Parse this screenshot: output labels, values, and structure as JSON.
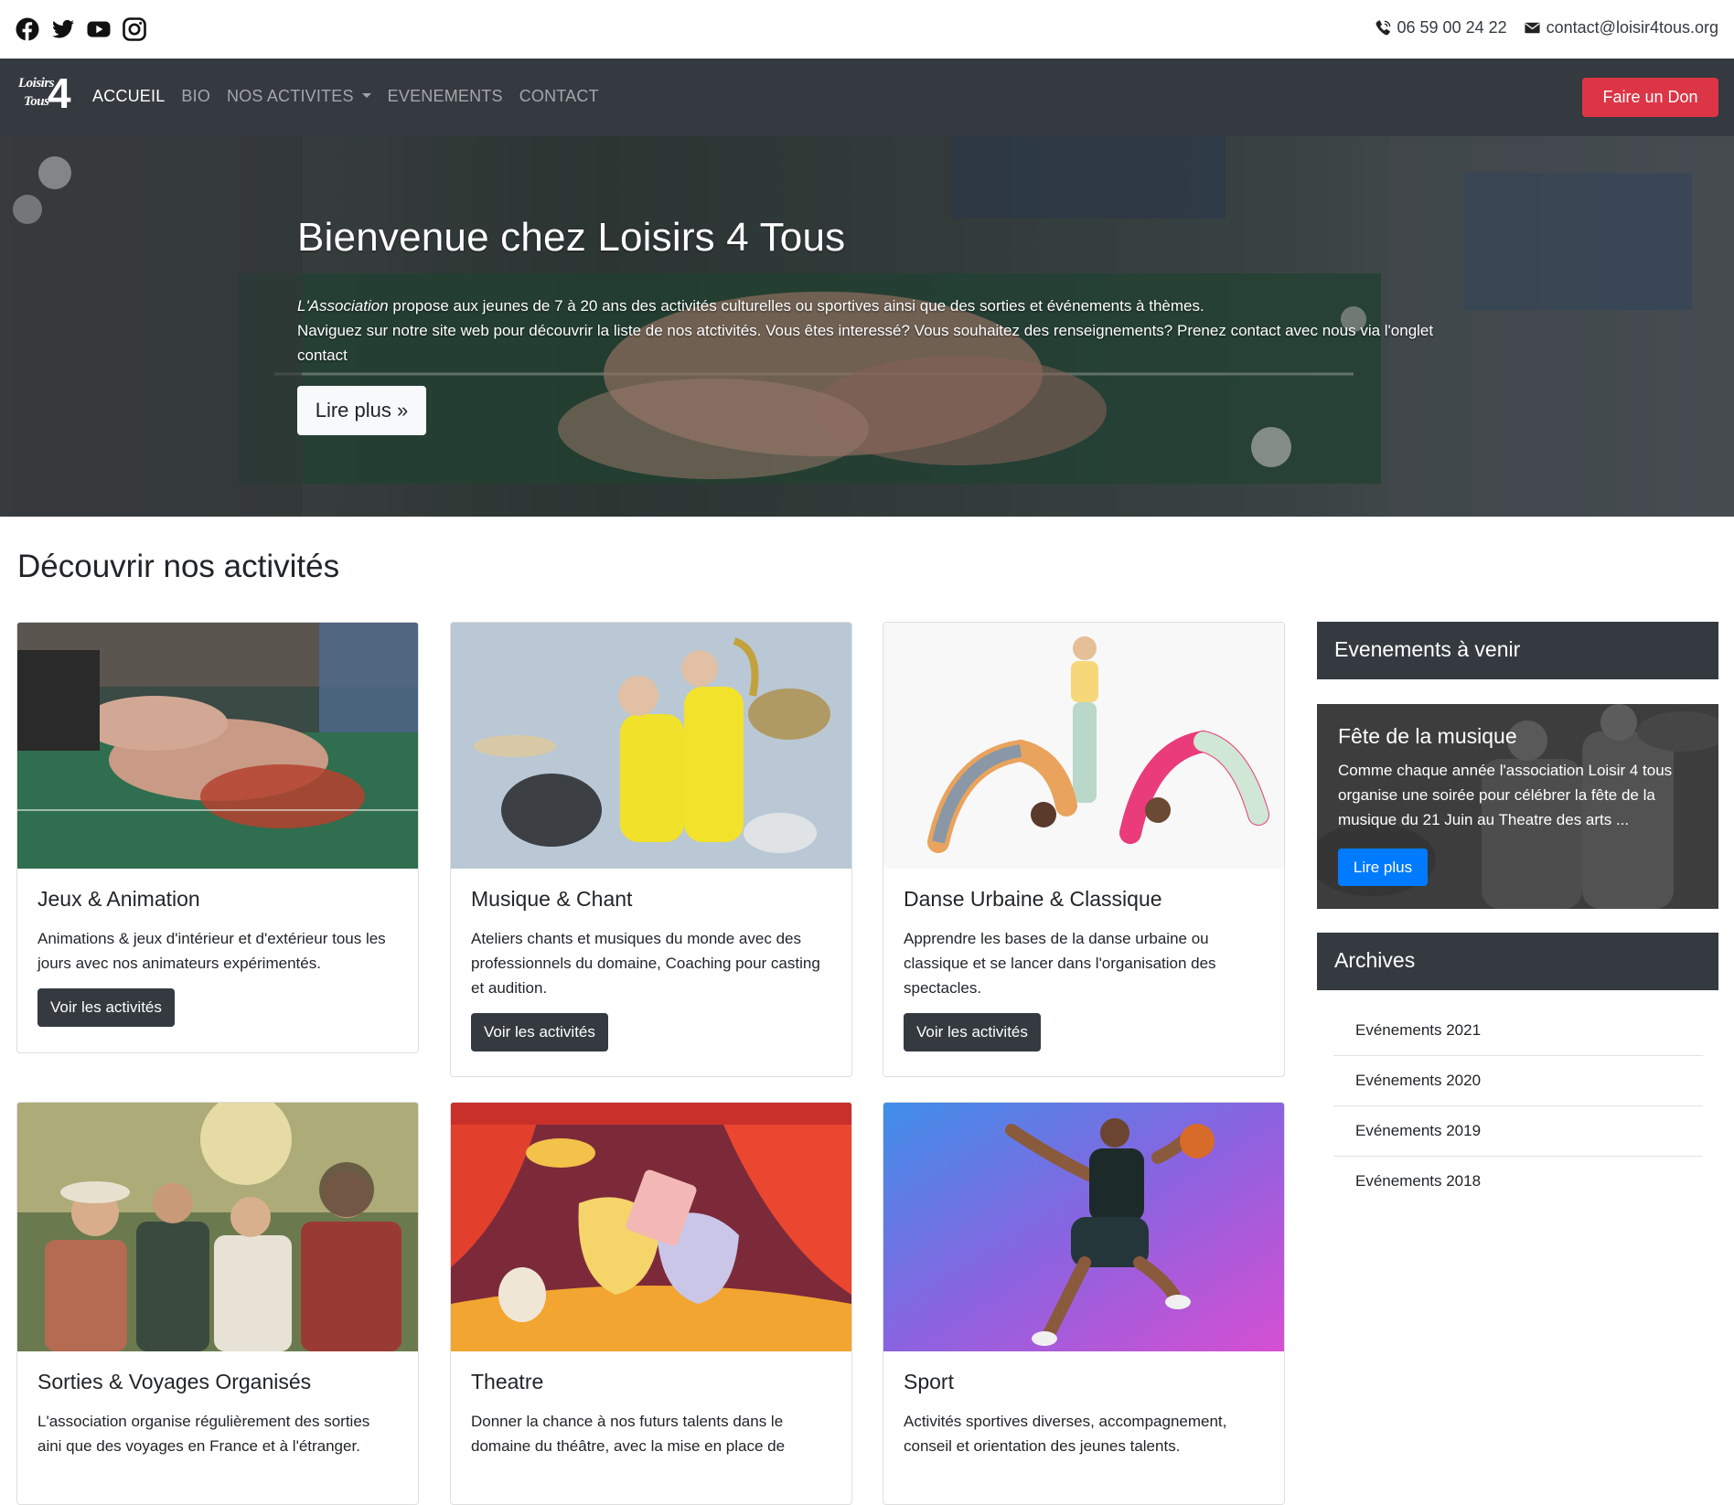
{
  "topbar": {
    "social": [
      "facebook-icon",
      "twitter-icon",
      "youtube-icon",
      "instagram-icon"
    ],
    "phone": "06 59 00 24 22",
    "email": "contact@loisir4tous.org"
  },
  "navbar": {
    "logo": {
      "line1": "Loisirs",
      "line2": "Tous",
      "number": "4"
    },
    "items": [
      {
        "label": "ACCUEIL",
        "active": true
      },
      {
        "label": "BIO"
      },
      {
        "label": "NOS ACTIVITES",
        "dropdown": true
      },
      {
        "label": "EVENEMENTS"
      },
      {
        "label": "CONTACT"
      }
    ],
    "donate_label": "Faire un Don",
    "colors": {
      "bg": "#343a40",
      "donate": "#dc3545"
    }
  },
  "hero": {
    "title": "Bienvenue chez Loisirs 4 Tous",
    "lead_emphasis": "L'Association",
    "lead_line1": " propose aux jeunes de 7 à 20 ans des activités culturelles ou sportives ainsi que des sorties et événements à thèmes.",
    "lead_line2": "Naviguez sur notre site web pour découvrir la liste de nos atctivités. Vous êtes interessé? Vous souhaitez des renseignements? Prenez contact avec nous via l'onglet contact",
    "button_label": "Lire plus »"
  },
  "section_title": "Découvrir nos activités",
  "cards": [
    {
      "title": "Jeux & Animation",
      "text": "Animations & jeux d'intérieur et d'extérieur tous les jours avec nos animateurs expérimentés.",
      "button_label": "Voir les activités",
      "image": "foosball-hands-photo"
    },
    {
      "title": "Musique & Chant",
      "text": "Ateliers chants et musiques du monde avec des professionnels du domaine, Coaching pour casting et audition.",
      "button_label": "Voir les activités",
      "image": "girls-drums-saxophone-photo"
    },
    {
      "title": "Danse Urbaine & Classique",
      "text": "Apprendre les bases de la danse urbaine ou classique et se lancer dans l'organisation des spectacles.",
      "button_label": "Voir les activités",
      "image": "kids-dancing-photo"
    },
    {
      "title": "Sorties & Voyages Organisés",
      "text": "L'association organise régulièrement des sorties aini que des voyages en France et à l'étranger.",
      "image": "friends-outdoor-photo"
    },
    {
      "title": "Theatre",
      "text": "Donner la chance à nos futurs talents dans le domaine du théâtre, avec la mise en place de",
      "image": "theatre-masks-illustration"
    },
    {
      "title": "Sport",
      "text": "Activités sportives diverses, accompagnement, conseil et orientation des jeunes talents.",
      "image": "basketball-player-photo"
    }
  ],
  "sidebar": {
    "upcoming_title": "Evenements à venir",
    "event": {
      "title": "Fête de la musique",
      "text": "Comme chaque année l'association Loisir 4 tous organise une soirée pour célébrer la fête de la musique du 21 Juin au Theatre des arts ...",
      "button_label": "Lire plus"
    },
    "archives_title": "Archives",
    "archives": [
      "Evénements 2021",
      "Evénements 2020",
      "Evénements 2019",
      "Evénements 2018"
    ]
  }
}
